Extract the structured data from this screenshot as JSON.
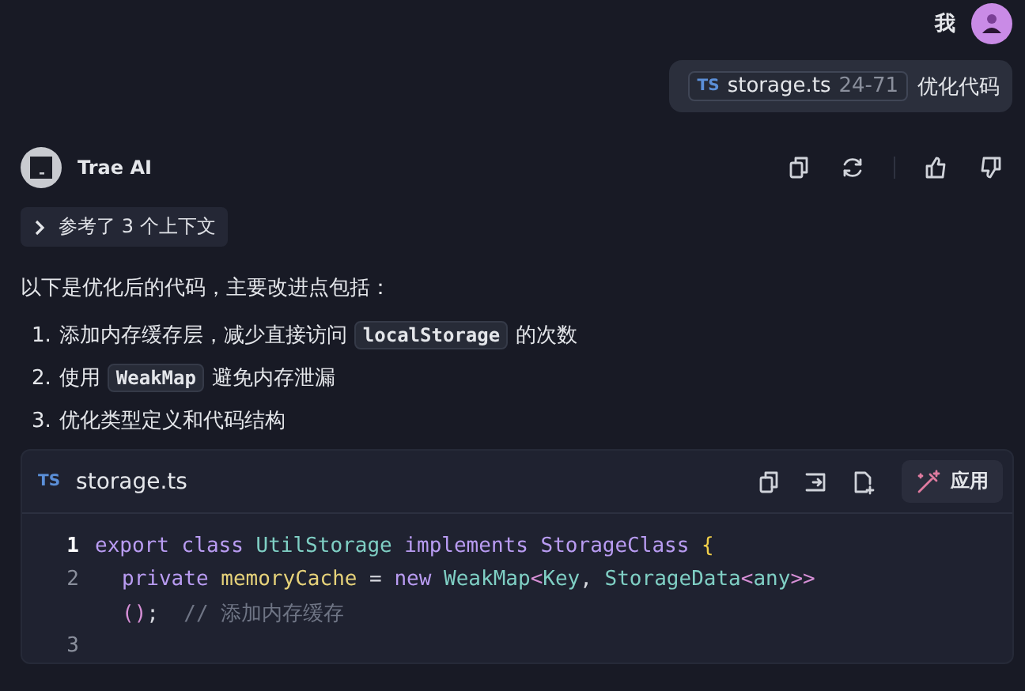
{
  "user": {
    "name": "我",
    "chip": {
      "lang": "TS",
      "file": "storage.ts",
      "range": "24-71"
    },
    "message": "优化代码"
  },
  "assistant": {
    "name": "Trae AI",
    "context_button": {
      "label": "参考了 3 个上下文",
      "expanded": false
    },
    "intro": "以下是优化后的代码，主要改进点包括：",
    "points": [
      {
        "number": "1.",
        "parts": [
          {
            "kind": "text",
            "text": "添加内存缓存层，减少直接访问"
          },
          {
            "kind": "code",
            "text": "localStorage"
          },
          {
            "kind": "text",
            "text": "的次数"
          }
        ]
      },
      {
        "number": "2.",
        "parts": [
          {
            "kind": "text",
            "text": "使用"
          },
          {
            "kind": "code",
            "text": "WeakMap"
          },
          {
            "kind": "text",
            "text": "避免内存泄漏"
          }
        ]
      },
      {
        "number": "3.",
        "parts": [
          {
            "kind": "text",
            "text": "优化类型定义和代码结构"
          }
        ]
      }
    ],
    "code_block": {
      "lang": "TS",
      "file": "storage.ts",
      "apply_label": "应用",
      "rows": [
        {
          "number": "1",
          "current": true,
          "tokens": [
            {
              "kind": "keyword",
              "text": "export class "
            },
            {
              "kind": "type",
              "text": "UtilStorage "
            },
            {
              "kind": "keyword",
              "text": "implements StorageClass "
            },
            {
              "kind": "brace",
              "text": "{"
            }
          ]
        },
        {
          "number": "2",
          "current": false,
          "indented": true,
          "tokens": [
            {
              "kind": "keyword",
              "text": "private "
            },
            {
              "kind": "name",
              "text": "memoryCache "
            },
            {
              "kind": "plain",
              "text": "= "
            },
            {
              "kind": "keyword",
              "text": "new "
            },
            {
              "kind": "type",
              "text": "WeakMap"
            },
            {
              "kind": "bracket",
              "text": "<"
            },
            {
              "kind": "type",
              "text": "Key"
            },
            {
              "kind": "plain",
              "text": ", "
            },
            {
              "kind": "type",
              "text": "StorageData"
            },
            {
              "kind": "bracket",
              "text": "<"
            },
            {
              "kind": "type",
              "text": "any"
            },
            {
              "kind": "bracket",
              "text": ">>"
            }
          ]
        },
        {
          "indented": true,
          "tokens": [
            {
              "kind": "bracket",
              "text": "()"
            },
            {
              "kind": "plain",
              "text": ";  "
            },
            {
              "kind": "comment",
              "text": "// 添加内存缓存"
            }
          ]
        },
        {
          "number": "3",
          "current": false,
          "tokens": []
        }
      ]
    }
  }
}
